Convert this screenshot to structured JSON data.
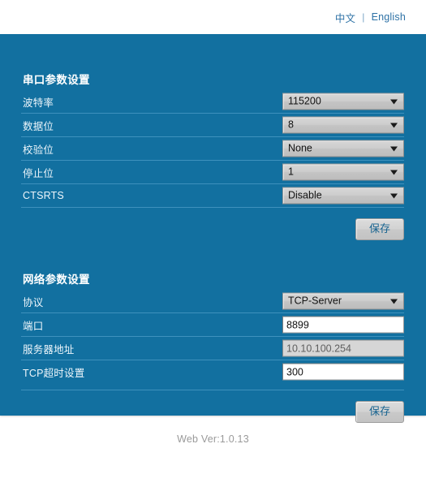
{
  "header": {
    "lang_zh": "中文",
    "lang_separator": "|",
    "lang_en": "English"
  },
  "serial_section": {
    "title": "串口参数设置",
    "rows": [
      {
        "label": "波特率",
        "value": "115200",
        "type": "select"
      },
      {
        "label": "数据位",
        "value": "8",
        "type": "select"
      },
      {
        "label": "校验位",
        "value": "None",
        "type": "select"
      },
      {
        "label": "停止位",
        "value": "1",
        "type": "select"
      },
      {
        "label": "CTSRTS",
        "value": "Disable",
        "type": "select"
      }
    ],
    "save_label": "保存"
  },
  "network_section": {
    "title": "网络参数设置",
    "rows": [
      {
        "label": "协议",
        "value": "TCP-Server",
        "type": "select"
      },
      {
        "label": "端口",
        "value": "8899",
        "type": "text"
      },
      {
        "label": "服务器地址",
        "value": "10.10.100.254",
        "type": "text-disabled"
      },
      {
        "label": "TCP超时设置",
        "value": "300",
        "type": "text"
      }
    ],
    "save_label": "保存"
  },
  "footer": {
    "version_text": "Web Ver:1.0.13"
  },
  "colors": {
    "panel_blue": "#1270a0",
    "rule_blue": "#3e91bd",
    "link_blue": "#2e72a6",
    "button_text": "#15628f"
  }
}
